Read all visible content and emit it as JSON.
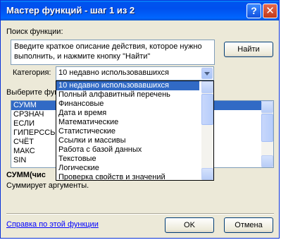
{
  "window": {
    "title": "Мастер функций - шаг 1 из 2",
    "help_glyph": "?",
    "close_glyph": "✕"
  },
  "search": {
    "label": "Поиск функции:",
    "text": "Введите краткое описание действия, которое нужно выполнить, и нажмите кнопку \"Найти\"",
    "find_button": "Найти"
  },
  "category": {
    "label": "Категория:",
    "selected": "10 недавно использовавшихся",
    "options": [
      "10 недавно использовавшихся",
      "Полный алфавитный перечень",
      "Финансовые",
      "Дата и время",
      "Математические",
      "Статистические",
      "Ссылки и массивы",
      "Работа с базой данных",
      "Текстовые",
      "Логические",
      "Проверка свойств и значений"
    ]
  },
  "functions": {
    "label": "Выберите фун",
    "items": [
      "СУММ",
      "СРЗНАЧ",
      "ЕСЛИ",
      "ГИПЕРССЫЛ",
      "СЧЁТ",
      "МАКС",
      "SIN"
    ],
    "selected_index": 0
  },
  "details": {
    "signature": "СУММ(чис",
    "description": "Суммирует аргументы."
  },
  "footer": {
    "help_link": "Справка по этой функции",
    "ok_button": "OK",
    "cancel_button": "Отмена"
  }
}
